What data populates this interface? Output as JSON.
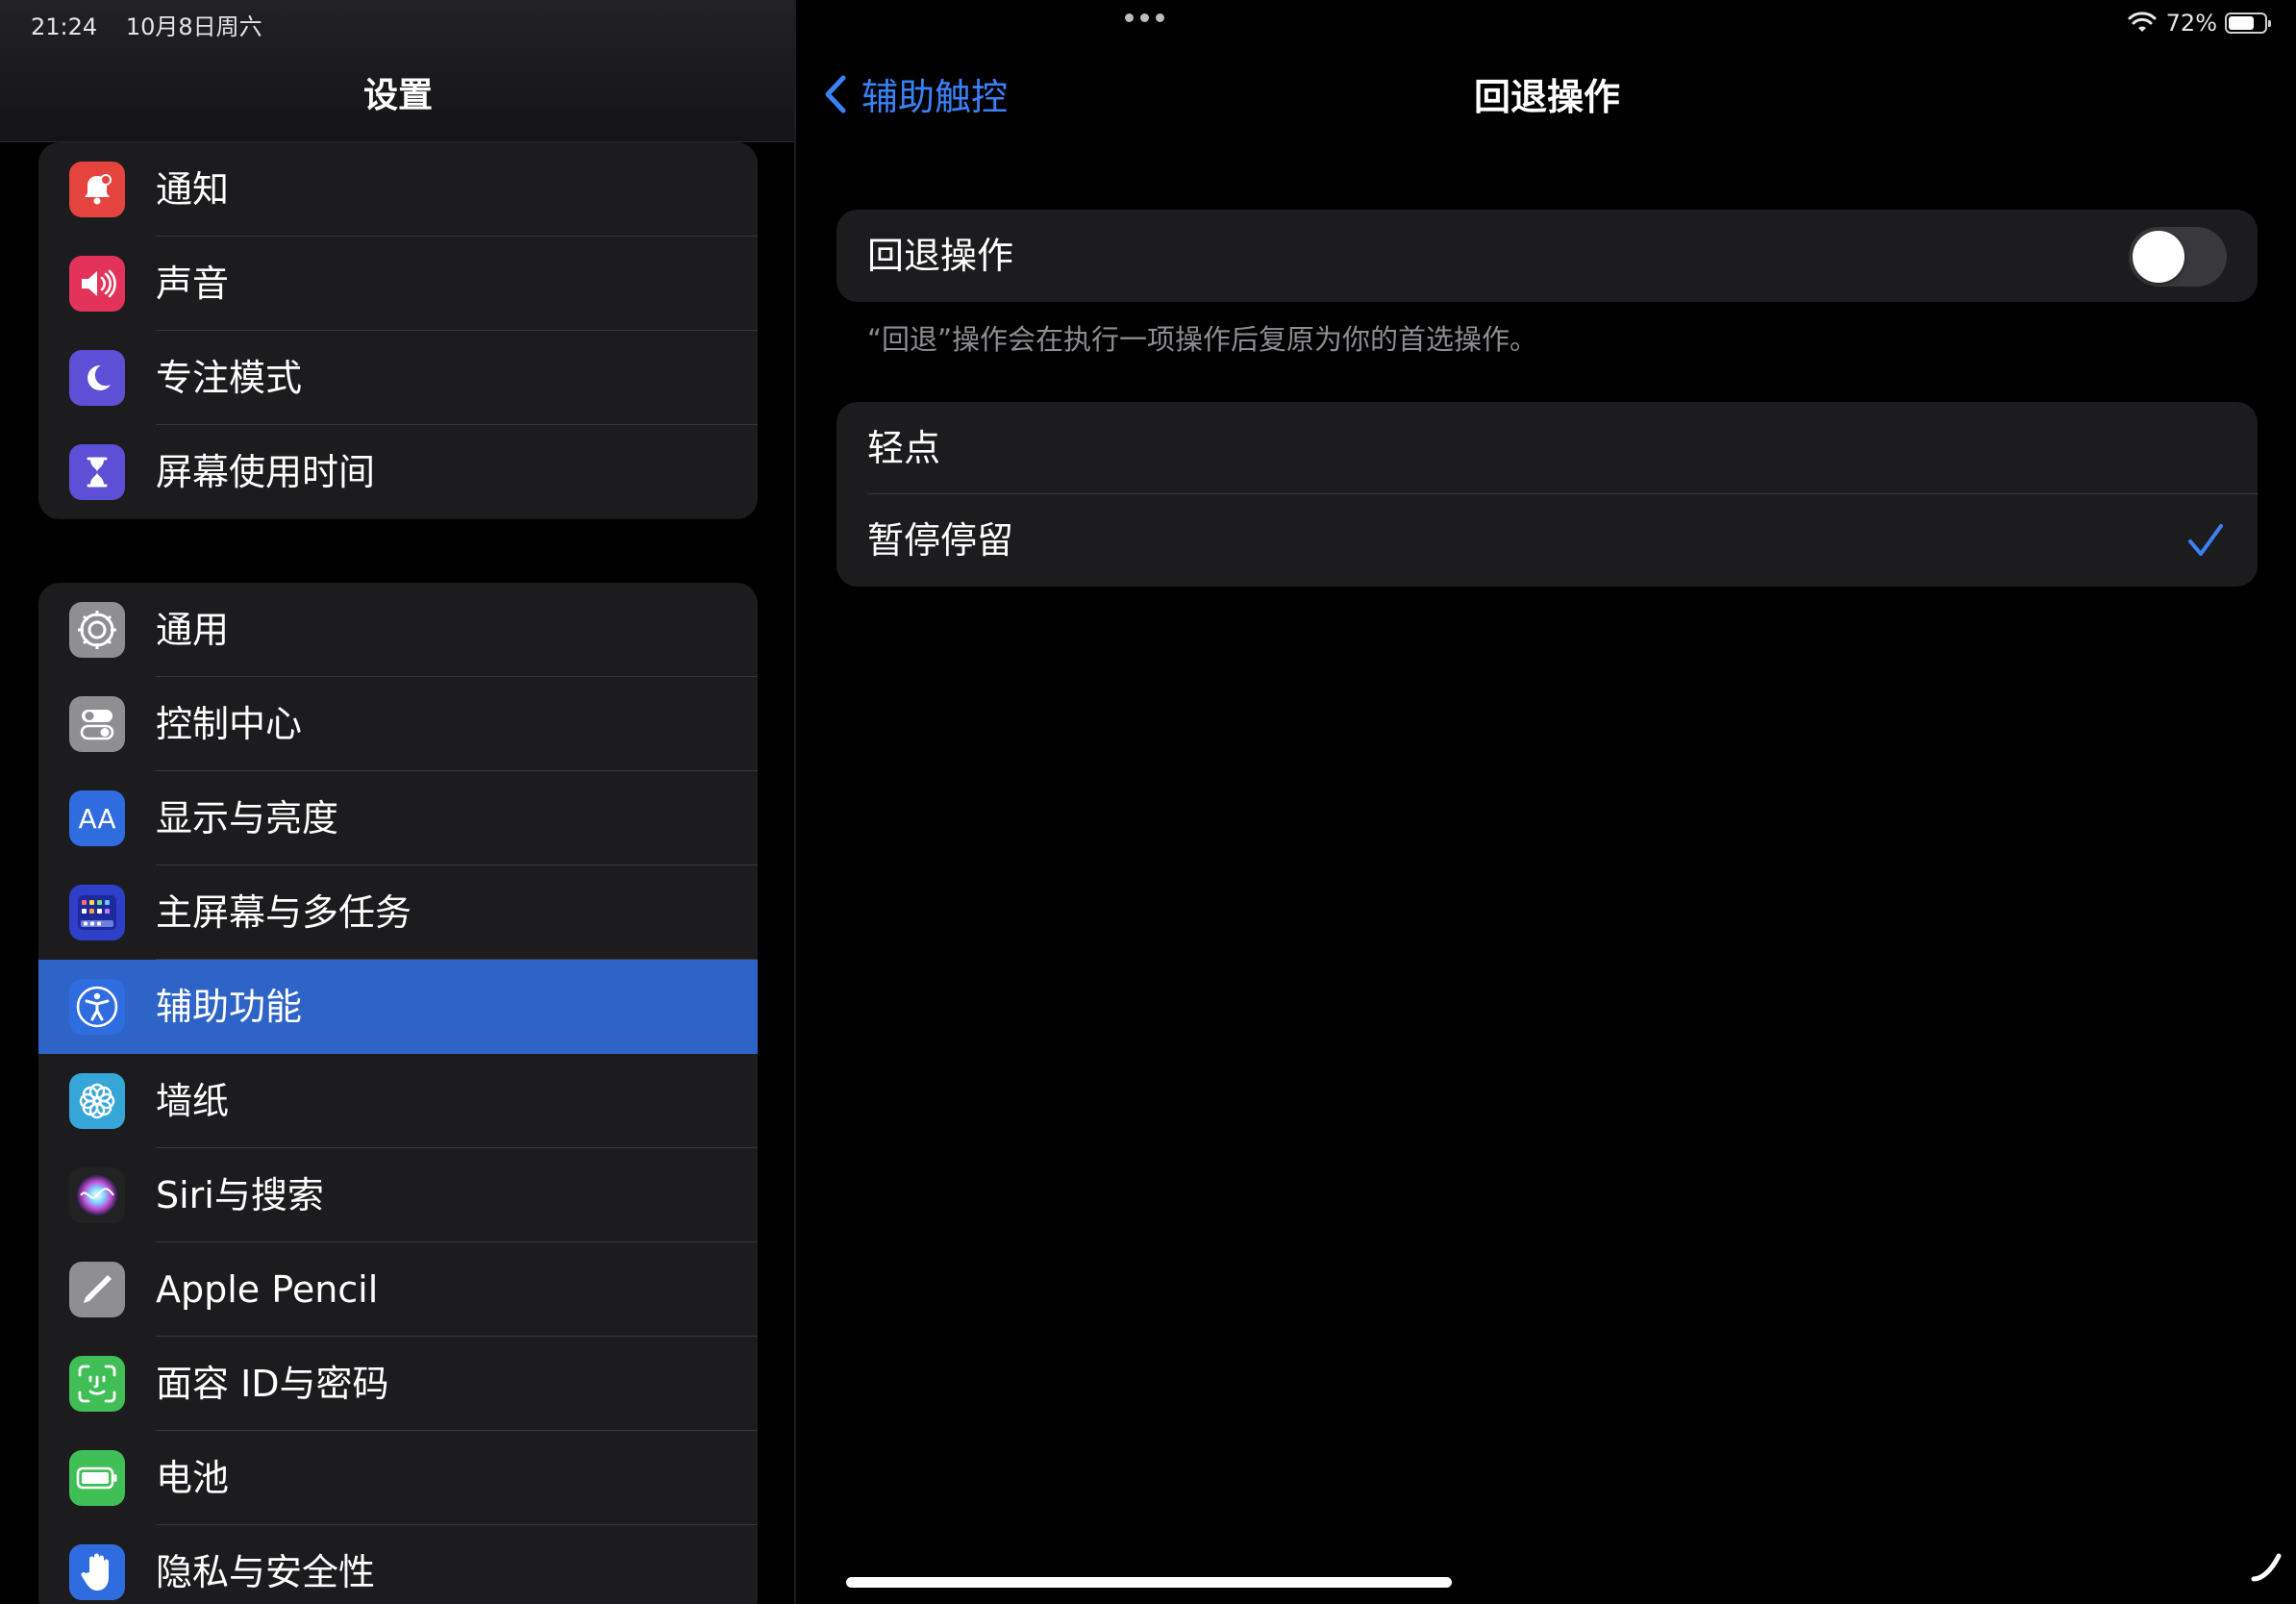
{
  "status_bar": {
    "time": "21:24",
    "date": "10月8日周六",
    "battery_pct": "72%",
    "battery_level": 0.72
  },
  "sidebar": {
    "title": "设置",
    "group1": [
      {
        "label": "通知",
        "icon": "bell-icon",
        "color": "#e5433d"
      },
      {
        "label": "声音",
        "icon": "speaker-icon",
        "color": "#e3335a"
      },
      {
        "label": "专注模式",
        "icon": "moon-icon",
        "color": "#5d4fd6"
      },
      {
        "label": "屏幕使用时间",
        "icon": "hourglass-icon",
        "color": "#5d4fd6"
      }
    ],
    "group2": [
      {
        "label": "通用",
        "icon": "gear-icon",
        "color": "#8e8e93"
      },
      {
        "label": "控制中心",
        "icon": "toggles-icon",
        "color": "#8e8e93"
      },
      {
        "label": "显示与亮度",
        "icon": "text-size-icon",
        "color": "#2f6ce0",
        "glyph": "AA"
      },
      {
        "label": "主屏幕与多任务",
        "icon": "home-grid-icon",
        "color": "#2f3fc9"
      },
      {
        "label": "辅助功能",
        "icon": "accessibility-icon",
        "color": "#2f6ce0",
        "selected": true
      },
      {
        "label": "墙纸",
        "icon": "flower-icon",
        "color": "#36a6d9"
      },
      {
        "label": "Siri与搜索",
        "icon": "siri-icon",
        "color": "#222222"
      },
      {
        "label": "Apple Pencil",
        "icon": "pencil-icon",
        "color": "#8e8e93"
      },
      {
        "label": "面容 ID与密码",
        "icon": "face-id-icon",
        "color": "#3fbf55"
      },
      {
        "label": "电池",
        "icon": "battery-icon",
        "color": "#3fbf55"
      },
      {
        "label": "隐私与安全性",
        "icon": "hand-icon",
        "color": "#2f6ce0"
      }
    ]
  },
  "detail": {
    "back_label": "辅助触控",
    "title": "回退操作",
    "toggle_label": "回退操作",
    "toggle_on": false,
    "footnote": "“回退”操作会在执行一项操作后复原为你的首选操作。",
    "options": [
      {
        "label": "轻点",
        "checked": false
      },
      {
        "label": "暂停停留",
        "checked": true
      }
    ]
  },
  "colors": {
    "accent": "#3a82f7",
    "selected_row": "#2e63c8",
    "card_bg": "#1c1c1e"
  }
}
